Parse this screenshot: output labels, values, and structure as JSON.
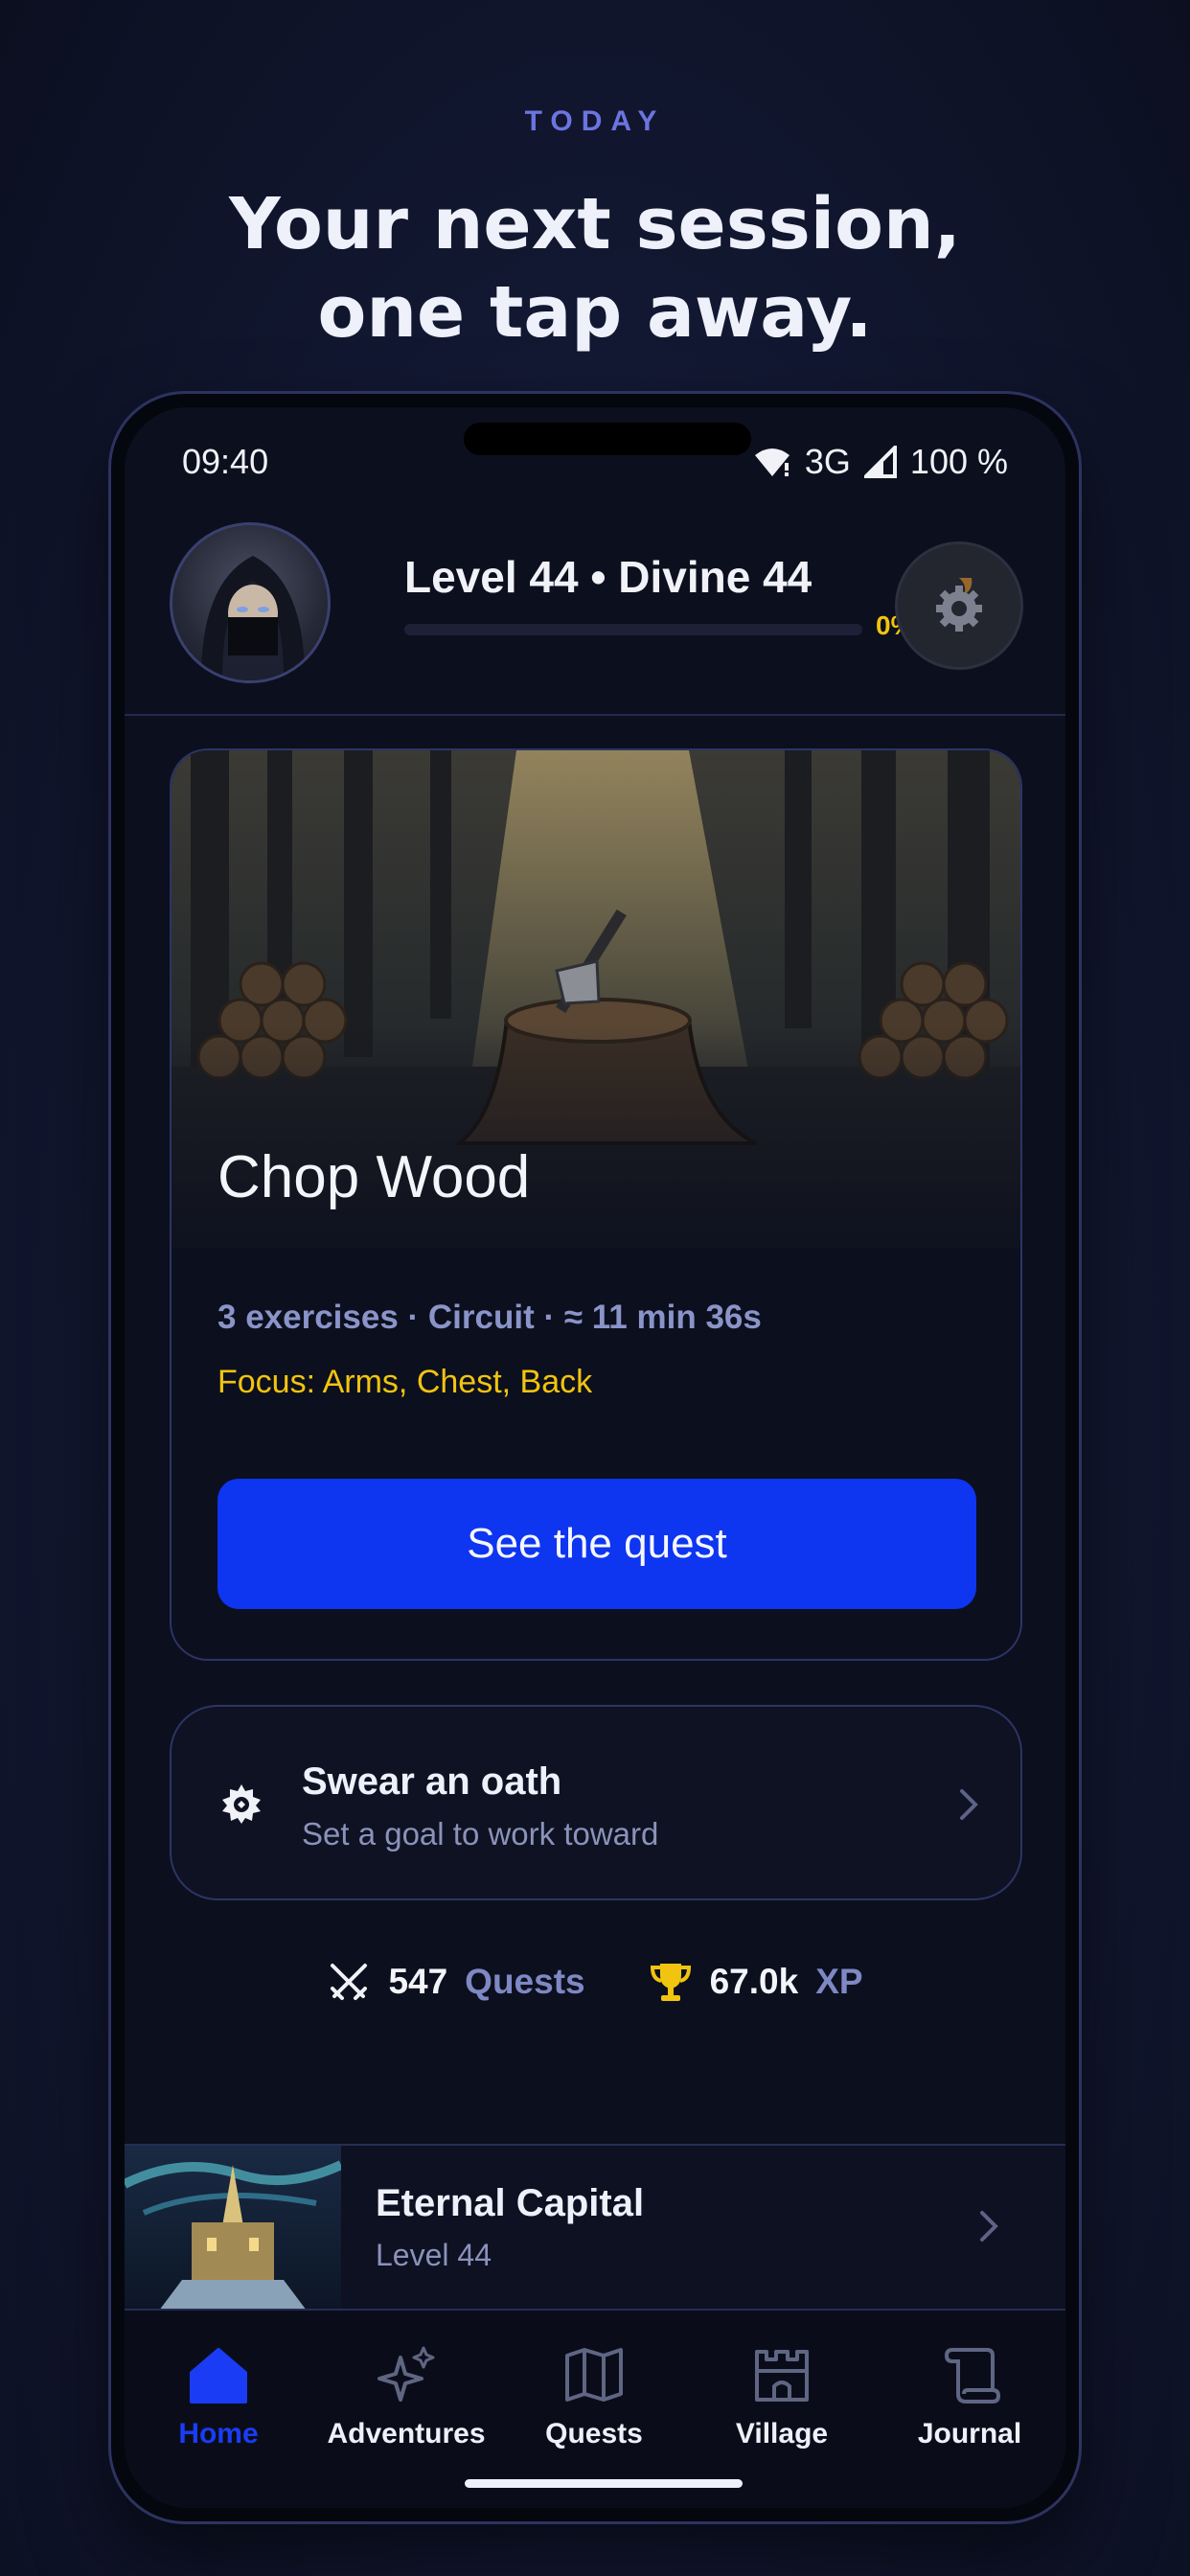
{
  "promo": {
    "eyebrow": "TODAY",
    "headline_line1": "Your next session,",
    "headline_line2": "one tap away."
  },
  "status_bar": {
    "time": "09:40",
    "network": "3G",
    "battery": "100 %"
  },
  "profile": {
    "level_text": "Level 44 • Divine 44",
    "xp_percent_label": "0%",
    "xp_progress": 0
  },
  "quest": {
    "title": "Chop Wood",
    "meta": "3 exercises · Circuit · ≈ 11 min 36s",
    "focus": "Focus: Arms, Chest, Back",
    "button_label": "See the quest"
  },
  "oath": {
    "title": "Swear an oath",
    "subtitle": "Set a goal to work toward"
  },
  "stats": {
    "quests_value": "547",
    "quests_label": "Quests",
    "xp_value": "67.0k",
    "xp_label": "XP"
  },
  "kingdom": {
    "name": "Eternal Capital",
    "level": "Level 44"
  },
  "tabs": [
    {
      "label": "Home",
      "icon": "home-icon",
      "active": true
    },
    {
      "label": "Adventures",
      "icon": "sparkles-icon",
      "active": false
    },
    {
      "label": "Quests",
      "icon": "map-icon",
      "active": false
    },
    {
      "label": "Village",
      "icon": "castle-icon",
      "active": false
    },
    {
      "label": "Journal",
      "icon": "scroll-icon",
      "active": false
    }
  ],
  "colors": {
    "accent": "#0e35f0",
    "gold": "#f1c40f",
    "muted_text": "#8b92ba",
    "background": "#0c0f1d"
  }
}
